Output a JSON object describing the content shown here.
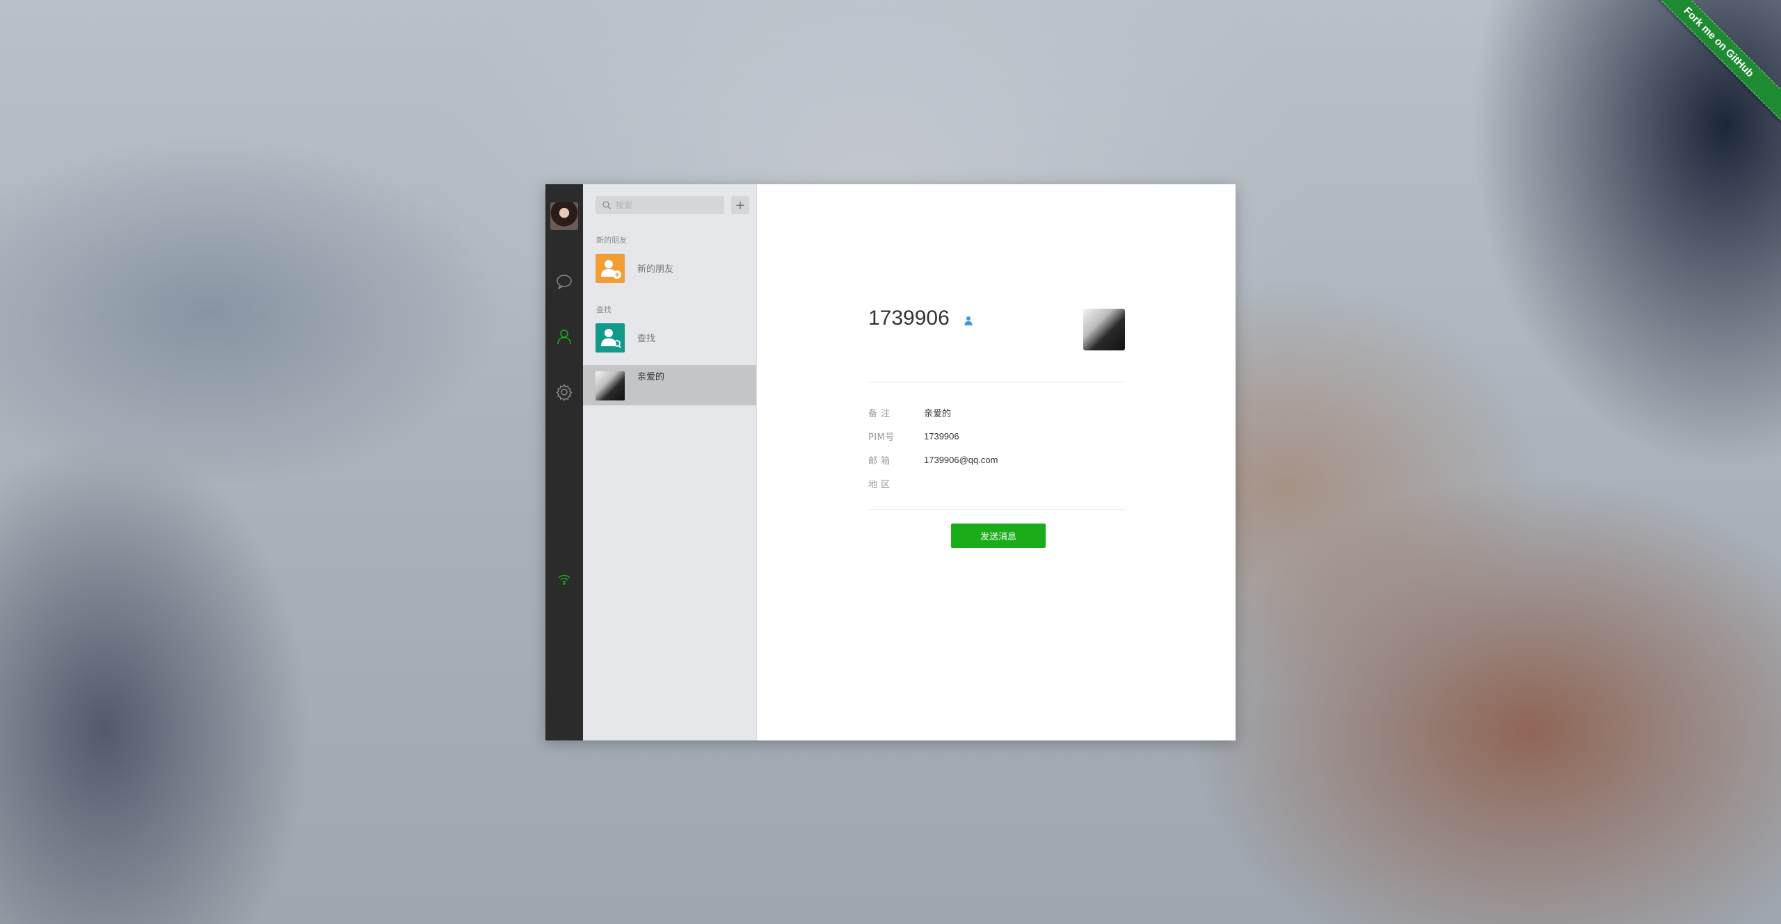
{
  "ribbon": {
    "text": "Fork me on GitHub"
  },
  "sidebar": {
    "icons": [
      "chat-icon",
      "contacts-icon",
      "settings-icon",
      "wifi-icon"
    ],
    "accent_color": "#1aad19"
  },
  "contacts": {
    "search_placeholder": "搜索",
    "add_label": "+",
    "groups": [
      {
        "label": "新的朋友",
        "item": "新的朋友"
      },
      {
        "label": "查找",
        "item": "查找"
      }
    ],
    "contact_list": [
      {
        "name": "亲爱的"
      }
    ]
  },
  "profile": {
    "name": "1739906",
    "fields": [
      {
        "label": "备  注",
        "value": "亲爱的"
      },
      {
        "label": "PIM号",
        "value": "1739906"
      },
      {
        "label": "邮  箱",
        "value": "1739906@qq.com"
      },
      {
        "label": "地  区",
        "value": ""
      }
    ],
    "send_button": "发送消息",
    "button_color": "#1aad19"
  }
}
